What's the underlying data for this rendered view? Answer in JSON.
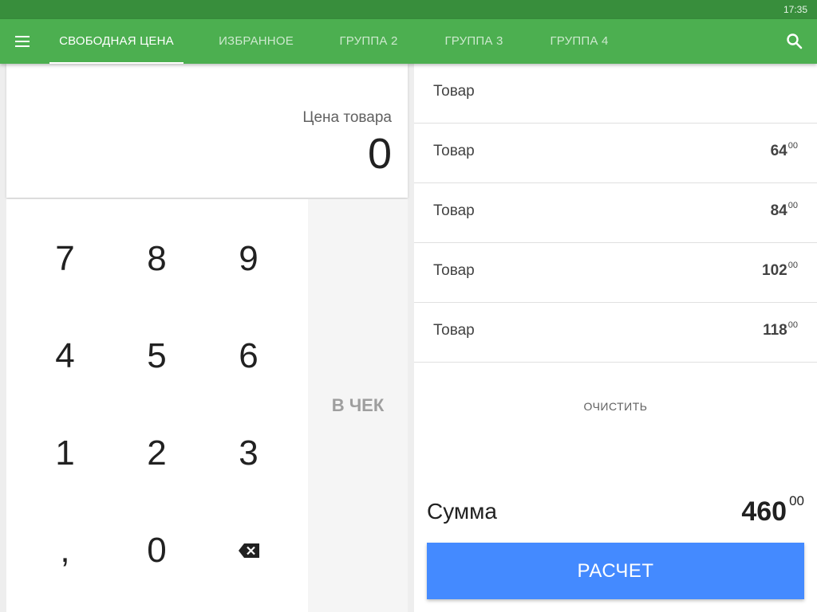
{
  "status_bar": {
    "time": "17:35"
  },
  "app_bar": {
    "tabs": [
      {
        "label": "СВОБОДНАЯ ЦЕНА",
        "active": true
      },
      {
        "label": "ИЗБРАННОЕ",
        "active": false
      },
      {
        "label": "ГРУППА 2",
        "active": false
      },
      {
        "label": "ГРУППА 3",
        "active": false
      },
      {
        "label": "ГРУППА 4",
        "active": false
      }
    ],
    "menu_icon": "menu-icon",
    "search_icon": "search-icon",
    "color": "#4caf50",
    "status_color": "#388e3c"
  },
  "price_input": {
    "label": "Цена товара",
    "value": "0"
  },
  "keypad": {
    "keys": [
      "7",
      "8",
      "9",
      "4",
      "5",
      "6",
      "1",
      "2",
      "3",
      ",",
      "0",
      "⌫"
    ],
    "backspace_icon": "backspace-icon"
  },
  "add_to_check": {
    "label": "В ЧЕК"
  },
  "check": {
    "items": [
      {
        "name": "Товар",
        "price_int": "",
        "price_dec": ""
      },
      {
        "name": "Товар",
        "price_int": "64",
        "price_dec": "00"
      },
      {
        "name": "Товар",
        "price_int": "84",
        "price_dec": "00"
      },
      {
        "name": "Товар",
        "price_int": "102",
        "price_dec": "00"
      },
      {
        "name": "Товар",
        "price_int": "118",
        "price_dec": "00"
      }
    ],
    "clear_label": "ОЧИСТИТЬ",
    "total_label": "Сумма",
    "total_int": "460",
    "total_dec": "00",
    "pay_label": "РАСЧЕТ",
    "pay_color": "#448aff"
  }
}
